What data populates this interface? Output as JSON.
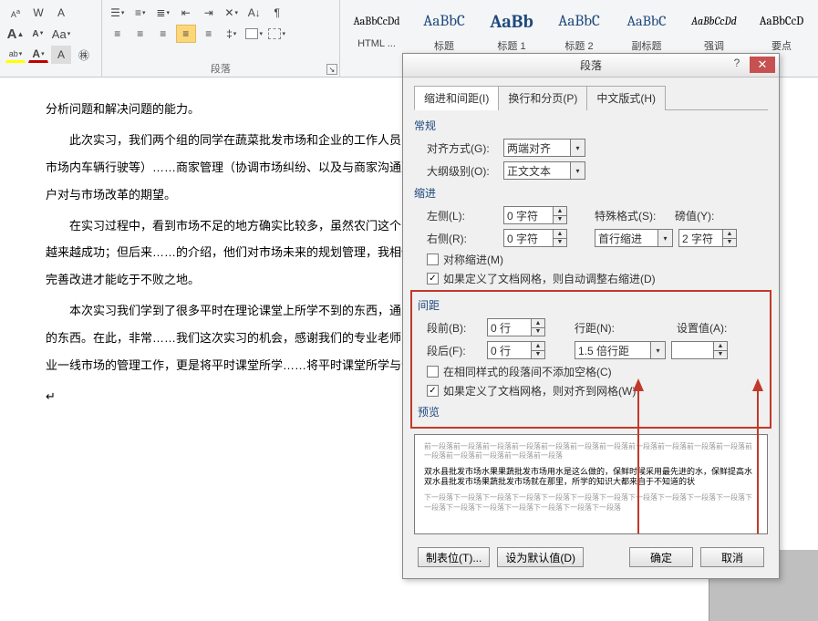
{
  "ribbon": {
    "group_para_label": "段落",
    "styles": [
      {
        "preview": "AaBbCcDd",
        "name": "HTML ...",
        "size": "12px",
        "color": "#000"
      },
      {
        "preview": "AaBbC",
        "name": "标题",
        "size": "17px",
        "color": "#1f497d"
      },
      {
        "preview": "AaBb",
        "name": "标题 1",
        "size": "20px",
        "color": "#1f497d",
        "bold": true
      },
      {
        "preview": "AaBbC",
        "name": "标题 2",
        "size": "17px",
        "color": "#1f497d"
      },
      {
        "preview": "AaBbC",
        "name": "副标题",
        "size": "16px",
        "color": "#1f497d"
      },
      {
        "preview": "AaBbCcDd",
        "name": "强调",
        "size": "12px",
        "color": "#000",
        "italic": true
      },
      {
        "preview": "AaBbCcD",
        "name": "要点",
        "size": "13px",
        "color": "#000"
      }
    ]
  },
  "document": {
    "p1": "分析问题和解决问题的能力。",
    "p2": "此次实习，我们两个组的同学在蔬菜批发市场和企业的工作人员……作内容为市场交通秩序的管理（包括车辆停放、市场内车辆行驶等）……商家管理（协调市场纠纷、以及与商家沟通）。与此同时，在空余时……市场情况，深深感受到商户对与市场改革的期望。",
    "p3": "在实习过程中，看到市场不足的地方确实比较多，虽然农门这个……果它的的市场不完善规划，加强管理，应该不会越来越成功；但后来……的介绍，他们对市场未来的规划管理，我相信市场会发展的越来越……势，不能坐吃山空，不断完善改进才能屹于不败之地。",
    "p4": "本次实习我们学到了很多平时在理论课堂上所学不到的东西，通……相结合，实习的时间不多，但我们却收获了不少的东西。在此，非常……我们这次实习的机会，感谢我们的专业老师为我们实习的事儿的费心……不仅参与了农户产品企业一线市场的管理工作，更是将平时课堂所学……将平时课堂所学与企业实际运行情况相结合，让我们不"
  },
  "dialog": {
    "title": "段落",
    "tabs": {
      "t1": "缩进和间距(I)",
      "t2": "换行和分页(P)",
      "t3": "中文版式(H)"
    },
    "general": {
      "title": "常规",
      "align_label": "对齐方式(G):",
      "align_value": "两端对齐",
      "outline_label": "大纲级别(O):",
      "outline_value": "正文文本"
    },
    "indent": {
      "title": "缩进",
      "left_label": "左侧(L):",
      "left_value": "0 字符",
      "right_label": "右侧(R):",
      "right_value": "0 字符",
      "special_label": "特殊格式(S):",
      "special_value": "首行缩进",
      "by_label": "磅值(Y):",
      "by_value": "2 字符",
      "mirror": "对称缩进(M)",
      "autogrid": "如果定义了文档网格，则自动调整右缩进(D)"
    },
    "spacing": {
      "title": "间距",
      "before_label": "段前(B):",
      "before_value": "0 行",
      "after_label": "段后(F):",
      "after_value": "0 行",
      "line_label": "行距(N):",
      "line_value": "1.5 倍行距",
      "at_label": "设置值(A):",
      "at_value": "",
      "nosame": "在相同样式的段落间不添加空格(C)",
      "snapgrid": "如果定义了文档网格，则对齐到网格(W)"
    },
    "preview_title": "预览",
    "preview_text_top": "前一段落前一段落前一段落前一段落前一段落前一段落前一段落前一段落前一段落前一段落前一段落前一段落前一段落前一段落前一段落前一段落",
    "preview_text_mid": "双水县批发市场水果果蔬批发市场用水是这么做的，保鲜时候采用最先进的水，保鲜提高水双水县批发市场果蔬批发市场就在那里，所学的知识大都来自于不知道的状",
    "preview_text_bot": "下一段落下一段落下一段落下一段落下一段落下一段落下一段落下一段落下一段落下一段落下一段落下一段落下一段落下一段落下一段落下一段落下一段落下一段落",
    "buttons": {
      "tabs": "制表位(T)...",
      "default": "设为默认值(D)",
      "ok": "确定",
      "cancel": "取消"
    }
  }
}
